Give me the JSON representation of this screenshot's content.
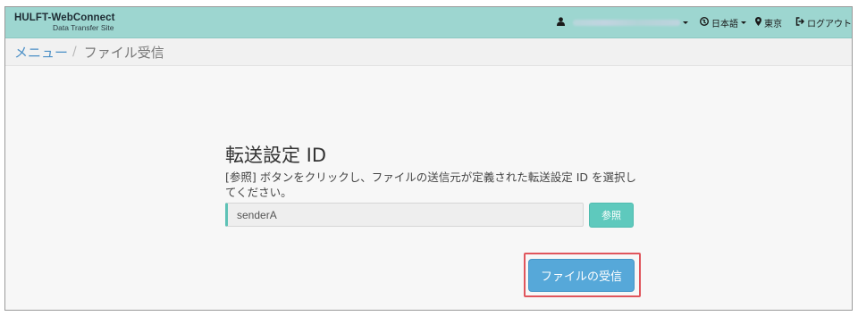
{
  "header": {
    "brand_title": "HULFT-WebConnect",
    "brand_subtitle": "Data Transfer Site",
    "language_label": "日本語",
    "location_label": "東京",
    "logout_label": "ログアウト"
  },
  "icons": {
    "user": "user-icon",
    "globe": "globe-icon",
    "location": "map-marker-icon",
    "logout": "sign-out-icon"
  },
  "breadcrumb": {
    "menu_label": "メニュー",
    "separator": "/",
    "current_label": "ファイル受信"
  },
  "form": {
    "title": "転送設定 ID",
    "description": "[参照] ボタンをクリックし、ファイルの送信元が定義された転送設定 ID を選択してください。",
    "sender_value": "senderA",
    "browse_label": "参照",
    "receive_label": "ファイルの受信"
  },
  "colors": {
    "navbar": "#9dd6d0",
    "accent_teal": "#5ec9bd",
    "primary_blue": "#56a8d9",
    "highlight_red": "#e0555c",
    "link_blue": "#4a8fc6"
  }
}
